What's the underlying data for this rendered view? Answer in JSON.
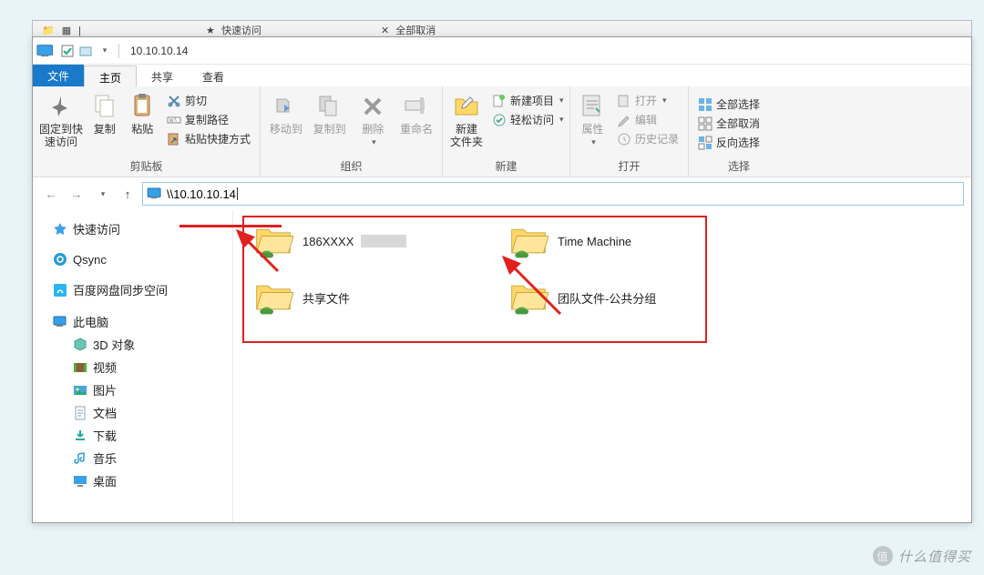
{
  "bg_hints": [
    "快速访问",
    "全部取消"
  ],
  "titlebar": {
    "title": "10.10.10.14"
  },
  "tabs": {
    "file": "文件",
    "home": "主页",
    "share": "共享",
    "view": "查看"
  },
  "ribbon": {
    "clipboard": {
      "label": "剪贴板",
      "pin": "固定到快\n速访问",
      "copy": "复制",
      "paste": "粘贴",
      "cut": "剪切",
      "copypath": "复制路径",
      "pasteshortcut": "粘贴快捷方式"
    },
    "organize": {
      "label": "组织",
      "moveto": "移动到",
      "copyto": "复制到",
      "del": "删除",
      "rename": "重命名"
    },
    "new": {
      "label": "新建",
      "newfolder": "新建\n文件夹",
      "newitem": "新建项目",
      "easyaccess": "轻松访问"
    },
    "open": {
      "label": "打开",
      "properties": "属性",
      "open": "打开",
      "edit": "编辑",
      "history": "历史记录"
    },
    "select": {
      "label": "选择",
      "selectall": "全部选择",
      "selectnone": "全部取消",
      "invert": "反向选择"
    }
  },
  "address": "\\\\10.10.10.14",
  "sidebar": {
    "quick": "快速访问",
    "qsync": "Qsync",
    "baidu": "百度网盘同步空间",
    "thispc": "此电脑",
    "items": [
      {
        "label": "3D 对象"
      },
      {
        "label": "视频"
      },
      {
        "label": "图片"
      },
      {
        "label": "文档"
      },
      {
        "label": "下载"
      },
      {
        "label": "音乐"
      },
      {
        "label": "桌面"
      }
    ]
  },
  "folders": [
    {
      "label": "186XXXX"
    },
    {
      "label": "Time Machine"
    },
    {
      "label": "共享文件"
    },
    {
      "label": "团队文件-公共分组"
    }
  ],
  "watermark": "什么值得买"
}
